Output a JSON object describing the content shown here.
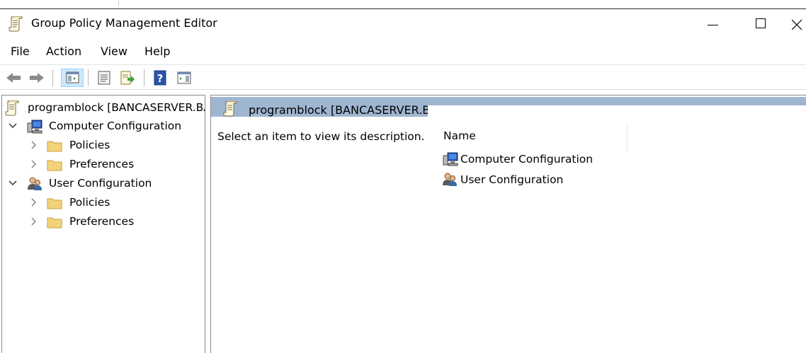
{
  "window": {
    "title": "Group Policy Management Editor",
    "icon": "gpo-scroll-icon",
    "controls": [
      "minimize",
      "maximize",
      "close"
    ]
  },
  "menu": [
    "File",
    "Action",
    "View",
    "Help"
  ],
  "toolbar": {
    "buttons": [
      "back-arrow",
      "forward-arrow",
      "show-hide-console-tree",
      "properties",
      "export-list",
      "help",
      "show-hide-action-pane"
    ]
  },
  "tree": {
    "root_label": "programblock [BANCASERVER.BANCA.LOCAL] Policy",
    "computer_config": {
      "label": "Computer Configuration",
      "children": [
        "Policies",
        "Preferences"
      ]
    },
    "user_config": {
      "label": "User Configuration",
      "children": [
        "Policies",
        "Preferences"
      ]
    }
  },
  "details": {
    "header_title": "programblock [BANCASERVER.BANCA.LOCAL] Policy",
    "description": "Select an item to view its description.",
    "column_name": "Name",
    "items": [
      "Computer Configuration",
      "User Configuration"
    ]
  },
  "colors": {
    "header_band": "#9fb6d1",
    "toolbar_active": "#cce8ff",
    "folder": "#f3d37a",
    "pane_border": "#828790"
  }
}
